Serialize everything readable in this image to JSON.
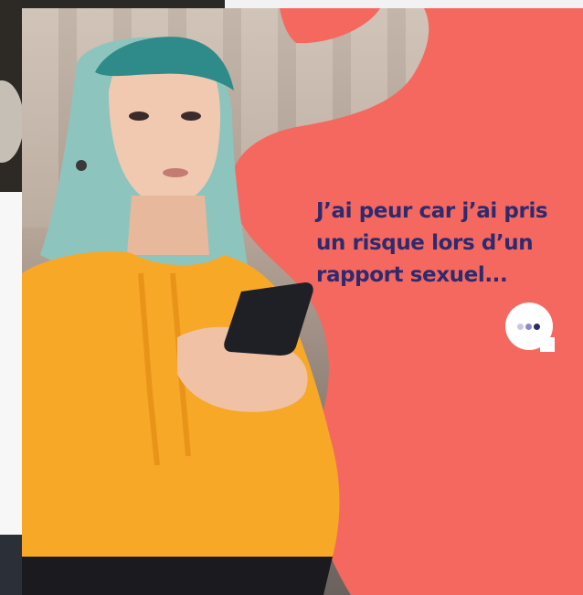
{
  "ad": {
    "message_lines": [
      "J’ai peur car j’ai pris",
      "un risque lors d’un",
      "rapport sexuel..."
    ],
    "typing_indicator_icon": "typing-dots-icon"
  },
  "colors": {
    "coral": "#f5685f",
    "text_navy": "#2d2a6e",
    "hoodie": "#f7a827",
    "hair": "#6fb2ad",
    "phone": "#1f1f26",
    "bubble_white": "#ffffff",
    "dot_light": "#c9c7e6",
    "dot_mid": "#8d89cd",
    "dot_dark": "#2d2a6e"
  }
}
